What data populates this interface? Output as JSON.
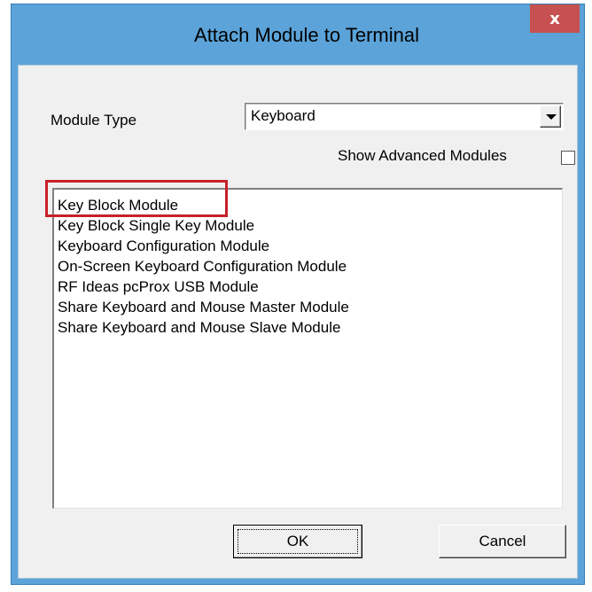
{
  "dialog": {
    "title": "Attach Module to Terminal",
    "close_glyph": "x"
  },
  "module_type": {
    "label": "Module Type",
    "selected": "Keyboard"
  },
  "advanced": {
    "label": "Show Advanced Modules",
    "checked": false
  },
  "modules": [
    "Key Block Module",
    "Key Block Single Key Module",
    "Keyboard Configuration Module",
    "On-Screen Keyboard Configuration Module",
    "RF Ideas pcProx USB Module",
    "Share Keyboard and Mouse Master Module",
    "Share Keyboard and Mouse Slave Module"
  ],
  "buttons": {
    "ok": "OK",
    "cancel": "Cancel"
  },
  "colors": {
    "frame": "#5ba3d8",
    "close": "#c75050",
    "highlight": "#c8202a"
  }
}
